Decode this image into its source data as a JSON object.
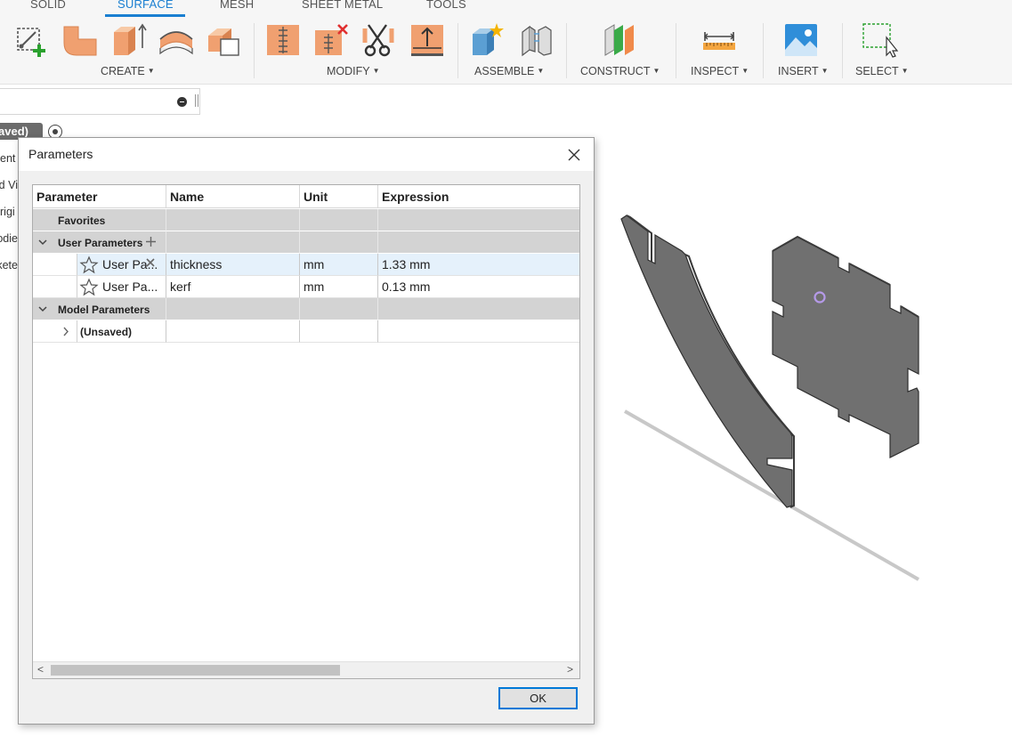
{
  "toolbar": {
    "tabs": [
      {
        "label": "SOLID",
        "active": false
      },
      {
        "label": "SURFACE",
        "active": true
      },
      {
        "label": "MESH",
        "active": false
      },
      {
        "label": "SHEET METAL",
        "active": false
      },
      {
        "label": "TOOLS",
        "active": false
      }
    ],
    "groups": [
      "CREATE",
      "MODIFY",
      "ASSEMBLE",
      "CONSTRUCT",
      "INSPECT",
      "INSERT",
      "SELECT"
    ],
    "icons": [
      "sketch-icon",
      "extrude-icon",
      "patch-icon",
      "loft-icon",
      "offset-surface-icon",
      "stitch-icon",
      "unstitch-icon",
      "trim-icon",
      "thicken-icon",
      "new-component-icon",
      "joint-icon",
      "offset-plane-icon",
      "measure-icon",
      "insert-image-icon",
      "select-icon"
    ],
    "accent_color": "#1a7fd1",
    "tool_orange": "#f0a070"
  },
  "browser": {
    "unsaved_label": "aved)",
    "items": [
      "ent",
      "d Vi",
      "rigi",
      "odie",
      "kete"
    ]
  },
  "dialog": {
    "title": "Parameters",
    "columns": [
      "Parameter",
      "Name",
      "Unit",
      "Expression"
    ],
    "groups": {
      "favorites": "Favorites",
      "user": "User Parameters",
      "model": "Model Parameters"
    },
    "user_parameters": [
      {
        "parameter": "User Pa...",
        "name": "thickness",
        "unit": "mm",
        "expression": "1.33 mm",
        "selected": true
      },
      {
        "parameter": "User Pa...",
        "name": "kerf",
        "unit": "mm",
        "expression": "0.13 mm",
        "selected": false
      }
    ],
    "model_child": "(Unsaved)",
    "ok_label": "OK"
  }
}
